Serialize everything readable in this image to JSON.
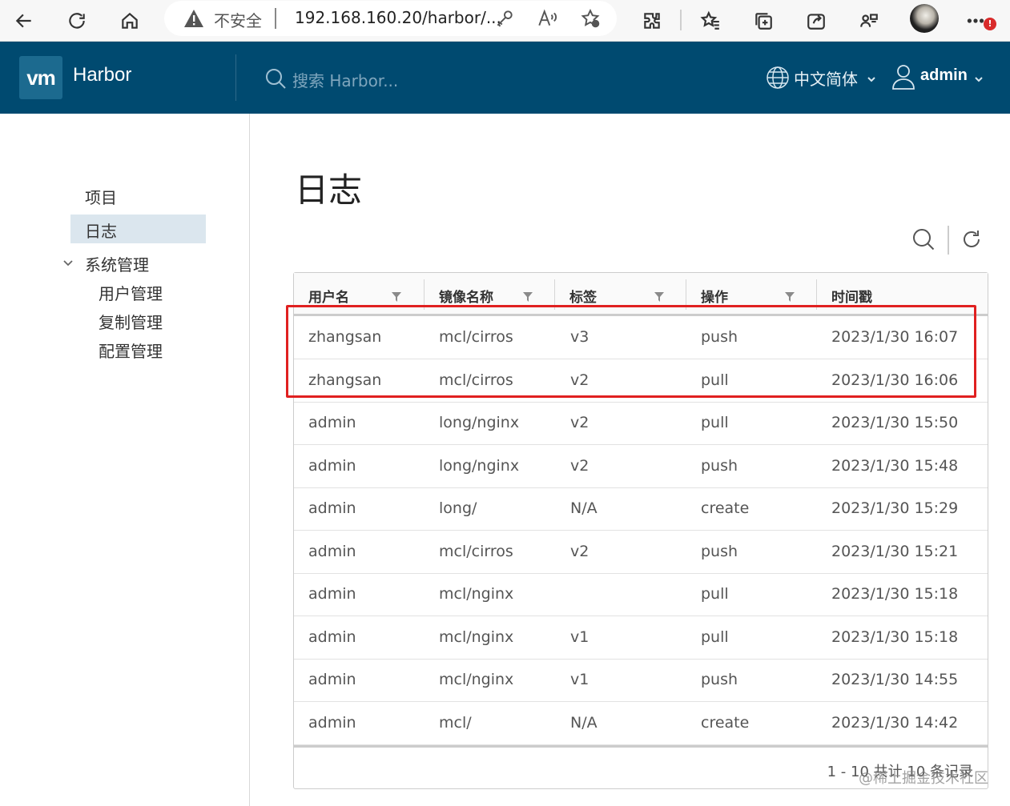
{
  "browser": {
    "security_label": "不安全",
    "url": "192.168.160.20/harbor/...",
    "notification_badge": "!"
  },
  "header": {
    "logo_text": "vm",
    "brand": "Harbor",
    "search_placeholder": "搜索 Harbor...",
    "language": "中文简体",
    "user": "admin"
  },
  "sidebar": {
    "items": [
      {
        "label": "项目"
      },
      {
        "label": "日志"
      },
      {
        "label": "系统管理"
      },
      {
        "label": "用户管理"
      },
      {
        "label": "复制管理"
      },
      {
        "label": "配置管理"
      }
    ]
  },
  "page": {
    "title": "日志"
  },
  "table": {
    "columns": [
      {
        "label": "用户名"
      },
      {
        "label": "镜像名称"
      },
      {
        "label": "标签"
      },
      {
        "label": "操作"
      },
      {
        "label": "时间戳"
      }
    ],
    "rows": [
      [
        "zhangsan",
        "mcl/cirros",
        "v3",
        "push",
        "2023/1/30 16:07"
      ],
      [
        "zhangsan",
        "mcl/cirros",
        "v2",
        "pull",
        "2023/1/30 16:06"
      ],
      [
        "admin",
        "long/nginx",
        "v2",
        "pull",
        "2023/1/30 15:50"
      ],
      [
        "admin",
        "long/nginx",
        "v2",
        "push",
        "2023/1/30 15:48"
      ],
      [
        "admin",
        "long/",
        "N/A",
        "create",
        "2023/1/30 15:29"
      ],
      [
        "admin",
        "mcl/cirros",
        "v2",
        "push",
        "2023/1/30 15:21"
      ],
      [
        "admin",
        "mcl/nginx",
        "",
        "pull",
        "2023/1/30 15:18"
      ],
      [
        "admin",
        "mcl/nginx",
        "v1",
        "pull",
        "2023/1/30 15:18"
      ],
      [
        "admin",
        "mcl/nginx",
        "v1",
        "push",
        "2023/1/30 14:55"
      ],
      [
        "admin",
        "mcl/",
        "N/A",
        "create",
        "2023/1/30 14:42"
      ]
    ],
    "footer": "1 - 10 共计 10 条记录"
  },
  "watermark": "@稀土掘金技术社区",
  "colors": {
    "header_bg": "#004a70",
    "highlight_border": "#e02020",
    "active_nav_bg": "#dbe6ee"
  }
}
